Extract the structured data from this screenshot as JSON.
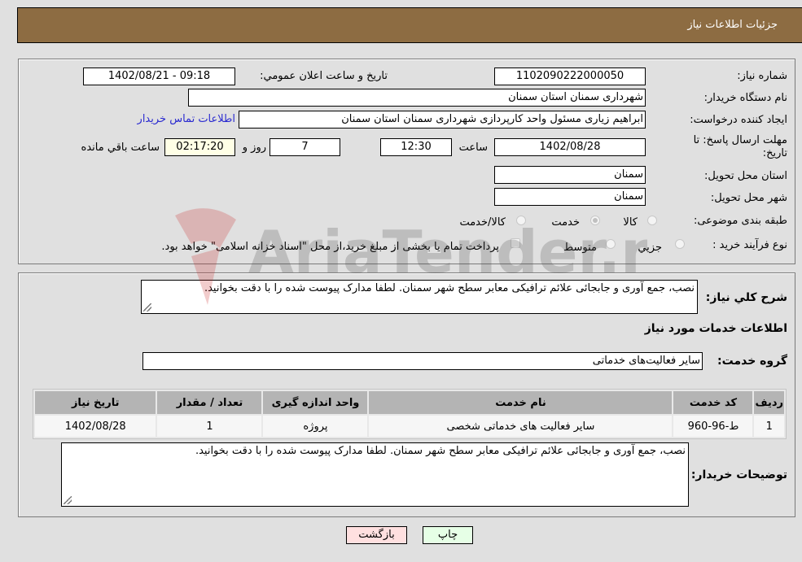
{
  "header": {
    "title": "جزئیات اطلاعات نیاز"
  },
  "details": {
    "need_number_label": "شماره نیاز:",
    "need_number": "1102090222000050",
    "announce_label": "تاریخ و ساعت اعلان عمومي:",
    "announce_value": "1402/08/21 - 09:18",
    "buyer_org_label": "نام دستگاه خريدار:",
    "buyer_org": "شهرداری سمنان استان سمنان",
    "creator_label": "ایجاد کننده درخواست:",
    "creator": "ابراهیم زیاری مسئول واحد کارپردازی شهرداری سمنان استان سمنان",
    "contact_link": "اطلاعات تماس خریدار",
    "deadline_label": "مهلت ارسال پاسخ: تا تاریخ:",
    "deadline_date": "1402/08/28",
    "time_label": "ساعت",
    "deadline_time": "12:30",
    "days_value": "7",
    "days_label": "روز و",
    "remaining_time": "02:17:20",
    "remaining_label": "ساعت باقي مانده",
    "province_label": "استان محل تحویل:",
    "province": "سمنان",
    "city_label": "شهر محل تحویل:",
    "city": "سمنان",
    "category_label": "طبقه بندی موضوعی:",
    "category_options": [
      {
        "label": "کالا",
        "selected": false
      },
      {
        "label": "خدمت",
        "selected": true
      },
      {
        "label": "کالا/خدمت",
        "selected": false
      }
    ],
    "process_label": "نوع فرآیند خرید :",
    "process_options": [
      {
        "label": "جزيي",
        "selected": false
      },
      {
        "label": "متوسط",
        "selected": false
      }
    ],
    "payment_note": "پرداخت تمام يا بخشی از مبلغ خرید،از محل \"اسناد خزانه اسلامی\" خواهد بود.",
    "payment_checked": false
  },
  "summary": {
    "label": "شرح کلي نياز:",
    "text": "نصب، جمع آوری و جابجائی علائم ترافیکی معابر سطح شهر سمنان. لطفا مدارک پیوست شده را با دقت بخوانید."
  },
  "services": {
    "section_title": "اطلاعات خدمات مورد نياز",
    "group_label": "گروه خدمت:",
    "group_value": "سایر فعالیت‌های خدماتی",
    "table": {
      "columns": [
        "رديف",
        "کد خدمت",
        "نام خدمت",
        "واحد اندازه گيری",
        "تعداد / مقدار",
        "تاريخ نياز"
      ],
      "rows": [
        [
          "1",
          "ط-96-960",
          "سایر فعالیت های خدماتی شخصی",
          "پروژه",
          "1",
          "1402/08/28"
        ]
      ]
    }
  },
  "buyer_notes": {
    "label": "توضيحات خريدار:",
    "text": "نصب، جمع آوری و جابجائی علائم ترافیکی معابر سطح شهر سمنان. لطفا مدارک پیوست شده را با دقت بخوانید."
  },
  "buttons": {
    "print": "چاپ",
    "back": "بازگشت"
  },
  "watermark": {
    "text": "AriaTender.neT"
  }
}
